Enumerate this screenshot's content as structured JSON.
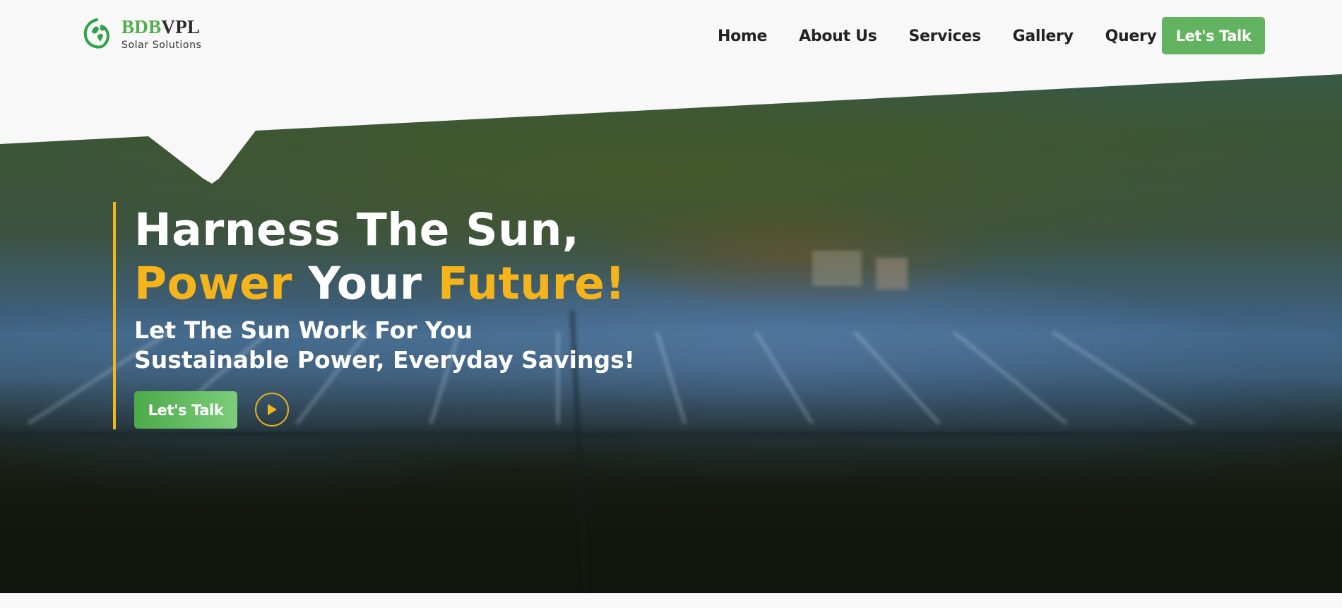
{
  "brand": {
    "name_part1": "BDB",
    "name_part2": "VPL",
    "tagline": "Solar Solutions"
  },
  "nav": {
    "items": [
      {
        "label": "Home"
      },
      {
        "label": "About Us"
      },
      {
        "label": "Services"
      },
      {
        "label": "Gallery"
      },
      {
        "label": "Query"
      }
    ],
    "cta_label": "Let's Talk"
  },
  "hero": {
    "headline_line1": "Harness The Sun,",
    "headline_line2": {
      "part1": "Power",
      "part2": " Your ",
      "part3": "Future!"
    },
    "subheadline_line1": "Let The Sun Work For You",
    "subheadline_line2": "Sustainable Power, Everyday Savings!",
    "cta_label": "Let's Talk",
    "play_icon": "play-icon"
  },
  "colors": {
    "accent_green": "#62b35f",
    "accent_yellow": "#f5b41b",
    "text_dark": "#222222"
  }
}
